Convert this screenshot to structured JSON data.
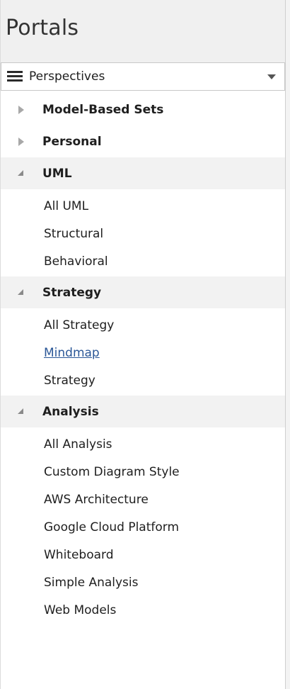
{
  "panel": {
    "title": "Portals"
  },
  "perspective_selector": {
    "icon": "hamburger-menu-icon",
    "selected": "Perspectives",
    "dropdown_icon": "chevron-down-icon"
  },
  "tree": {
    "groups": [
      {
        "label": "Model-Based Sets",
        "state": "collapsed",
        "items": []
      },
      {
        "label": "Personal",
        "state": "collapsed",
        "items": []
      },
      {
        "label": "UML",
        "state": "expanded",
        "items": [
          "All UML",
          "Structural",
          "Behavioral"
        ]
      },
      {
        "label": "Strategy",
        "state": "expanded",
        "items": [
          "All Strategy",
          "Mindmap",
          "Strategy"
        ]
      },
      {
        "label": "Analysis",
        "state": "expanded",
        "items": [
          "All Analysis",
          "Custom Diagram Style",
          "AWS Architecture",
          "Google Cloud Platform",
          "Whiteboard",
          "Simple Analysis",
          "Web Models"
        ]
      }
    ],
    "highlighted_item": "Mindmap"
  },
  "colors": {
    "header_background": "#f0f0f0",
    "group_background": "#f2f2f2",
    "link_color": "#2b5797",
    "text_color": "#1e1e1e"
  }
}
